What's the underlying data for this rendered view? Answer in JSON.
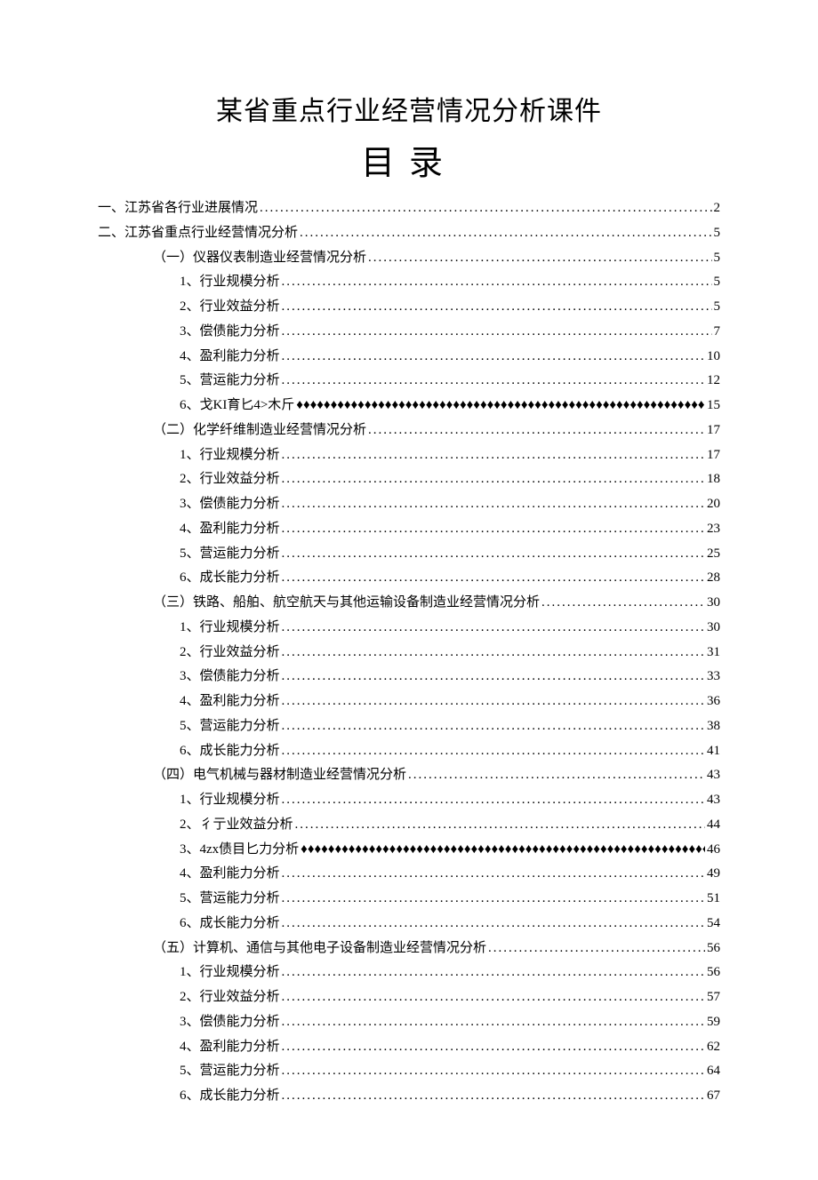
{
  "document": {
    "title": "某省重点行业经营情况分析课件",
    "toc_heading": "目录"
  },
  "toc": [
    {
      "indent": 0,
      "label": "一、江苏省各行业进展情况",
      "leader": "dots",
      "page": "2"
    },
    {
      "indent": 0,
      "label": "二、江苏省重点行业经营情况分析",
      "leader": "dots",
      "page": "5"
    },
    {
      "indent": 1,
      "label": "（一）仪器仪表制造业经营情况分析",
      "leader": "dots",
      "page": "5"
    },
    {
      "indent": 2,
      "label": "1、行业规模分析",
      "leader": "dots",
      "page": "5"
    },
    {
      "indent": 2,
      "label": "2、行业效益分析",
      "leader": "dots",
      "page": "5"
    },
    {
      "indent": 2,
      "label": "3、偿债能力分析",
      "leader": "dots",
      "page": "7"
    },
    {
      "indent": 2,
      "label": "4、盈利能力分析",
      "leader": "dots",
      "page": "10"
    },
    {
      "indent": 2,
      "label": "5、营运能力分析",
      "leader": "dots",
      "page": "12"
    },
    {
      "indent": 2,
      "label": "6、戈KI育匕4>木斤",
      "leader": "diamonds",
      "page": "15"
    },
    {
      "indent": 1,
      "label": "（二）化学纤维制造业经营情况分析",
      "leader": "dots",
      "page": "17"
    },
    {
      "indent": 2,
      "label": "1、行业规模分析",
      "leader": "dots",
      "page": "17"
    },
    {
      "indent": 2,
      "label": "2、行业效益分析",
      "leader": "dots",
      "page": "18"
    },
    {
      "indent": 2,
      "label": "3、偿债能力分析",
      "leader": "dots",
      "page": "20"
    },
    {
      "indent": 2,
      "label": "4、盈利能力分析",
      "leader": "dots",
      "page": "23"
    },
    {
      "indent": 2,
      "label": "5、营运能力分析",
      "leader": "dots",
      "page": "25"
    },
    {
      "indent": 2,
      "label": "6、成长能力分析",
      "leader": "dots",
      "page": "28"
    },
    {
      "indent": 1,
      "label": "（三）铁路、船舶、航空航天与其他运输设备制造业经营情况分析",
      "leader": "dots",
      "page": "30"
    },
    {
      "indent": 2,
      "label": "1、行业规模分析",
      "leader": "dots",
      "page": "30"
    },
    {
      "indent": 2,
      "label": "2、行业效益分析",
      "leader": "dots",
      "page": "31"
    },
    {
      "indent": 2,
      "label": "3、偿债能力分析",
      "leader": "dots",
      "page": "33"
    },
    {
      "indent": 2,
      "label": "4、盈利能力分析",
      "leader": "dots",
      "page": "36"
    },
    {
      "indent": 2,
      "label": "5、营运能力分析",
      "leader": "dots",
      "page": "38"
    },
    {
      "indent": 2,
      "label": "6、成长能力分析",
      "leader": "dots",
      "page": "41"
    },
    {
      "indent": 1,
      "label": "（四）电气机械与器材制造业经营情况分析",
      "leader": "dots",
      "page": "43"
    },
    {
      "indent": 2,
      "label": "1、行业规模分析",
      "leader": "dots",
      "page": "43"
    },
    {
      "indent": 2,
      "label": "2、彳亍业效益分析",
      "leader": "dots",
      "page": "44"
    },
    {
      "indent": 2,
      "label": "3、4zx债目匕力分析",
      "leader": "diamonds",
      "page": "46"
    },
    {
      "indent": 2,
      "label": "4、盈利能力分析",
      "leader": "dots",
      "page": "49"
    },
    {
      "indent": 2,
      "label": "5、营运能力分析",
      "leader": "dots",
      "page": "51"
    },
    {
      "indent": 2,
      "label": "6、成长能力分析",
      "leader": "dots",
      "page": "54"
    },
    {
      "indent": 1,
      "label": "（五）计算机、通信与其他电子设备制造业经营情况分析",
      "leader": "dots",
      "page": "56"
    },
    {
      "indent": 2,
      "label": "1、行业规模分析",
      "leader": "dots",
      "page": "56"
    },
    {
      "indent": 2,
      "label": "2、行业效益分析",
      "leader": "dots",
      "page": "57"
    },
    {
      "indent": 2,
      "label": "3、偿债能力分析",
      "leader": "dots",
      "page": "59"
    },
    {
      "indent": 2,
      "label": "4、盈利能力分析",
      "leader": "dots",
      "page": "62"
    },
    {
      "indent": 2,
      "label": "5、营运能力分析",
      "leader": "dots",
      "page": "64"
    },
    {
      "indent": 2,
      "label": "6、成长能力分析",
      "leader": "dots",
      "page": "67"
    }
  ]
}
